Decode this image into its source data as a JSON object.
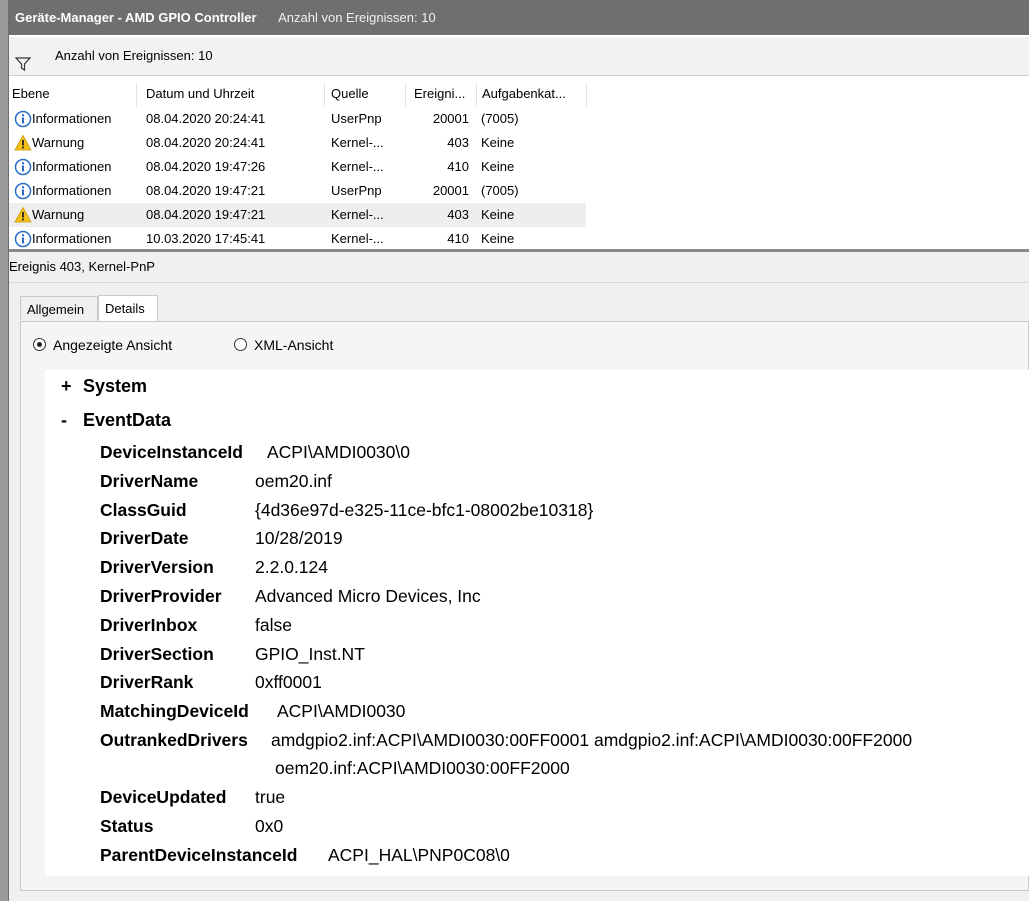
{
  "window": {
    "title": "Geräte-Manager - AMD GPIO Controller",
    "event_count_title": "Anzahl von Ereignissen: 10"
  },
  "filter": {
    "icon": "funnel-icon",
    "label": "Anzahl von Ereignissen: 10"
  },
  "grid": {
    "columns": [
      "Ebene",
      "Datum und Uhrzeit",
      "Quelle",
      "Ereigni...",
      "Aufgabenkat..."
    ],
    "rows": [
      {
        "level": "Informationen",
        "icon": "info-icon",
        "date": "08.04.2020 20:24:41",
        "source": "UserPnp",
        "id": "20001",
        "task": "(7005)",
        "selected": false
      },
      {
        "level": "Warnung",
        "icon": "warning-icon",
        "date": "08.04.2020 20:24:41",
        "source": "Kernel-...",
        "id": "403",
        "task": "Keine",
        "selected": false
      },
      {
        "level": "Informationen",
        "icon": "info-icon",
        "date": "08.04.2020 19:47:26",
        "source": "Kernel-...",
        "id": "410",
        "task": "Keine",
        "selected": false
      },
      {
        "level": "Informationen",
        "icon": "info-icon",
        "date": "08.04.2020 19:47:21",
        "source": "UserPnp",
        "id": "20001",
        "task": "(7005)",
        "selected": false
      },
      {
        "level": "Warnung",
        "icon": "warning-icon",
        "date": "08.04.2020 19:47:21",
        "source": "Kernel-...",
        "id": "403",
        "task": "Keine",
        "selected": true
      },
      {
        "level": "Informationen",
        "icon": "info-icon",
        "date": "10.03.2020 17:45:41",
        "source": "Kernel-...",
        "id": "410",
        "task": "Keine",
        "selected": false
      }
    ]
  },
  "event": {
    "header": "Ereignis 403, Kernel-PnP",
    "tabs": [
      {
        "label": "Allgemein",
        "active": false
      },
      {
        "label": "Details",
        "active": true
      }
    ],
    "view_options": [
      {
        "label": "Angezeigte Ansicht",
        "selected": true
      },
      {
        "label": "XML-Ansicht",
        "selected": false
      }
    ],
    "tree": {
      "system": {
        "sign": "+",
        "label": "System"
      },
      "eventdata": {
        "sign": "-",
        "label": "EventData"
      }
    },
    "fields": [
      {
        "key": "DeviceInstanceId",
        "value": "ACPI\\AMDI0030\\0"
      },
      {
        "key": "DriverName",
        "value": "oem20.inf"
      },
      {
        "key": "ClassGuid",
        "value": "{4d36e97d-e325-11ce-bfc1-08002be10318}"
      },
      {
        "key": "DriverDate",
        "value": "10/28/2019"
      },
      {
        "key": "DriverVersion",
        "value": "2.2.0.124"
      },
      {
        "key": "DriverProvider",
        "value": "Advanced Micro Devices, Inc"
      },
      {
        "key": "DriverInbox",
        "value": "false"
      },
      {
        "key": "DriverSection",
        "value": "GPIO_Inst.NT"
      },
      {
        "key": "DriverRank",
        "value": "0xff0001"
      },
      {
        "key": "MatchingDeviceId",
        "value": "ACPI\\AMDI0030"
      },
      {
        "key": "OutrankedDrivers",
        "value": "amdgpio2.inf:ACPI\\AMDI0030:00FF0001 amdgpio2.inf:ACPI\\AMDI0030:00FF2000",
        "value2": "oem20.inf:ACPI\\AMDI0030:00FF2000"
      },
      {
        "key": "DeviceUpdated",
        "value": "true"
      },
      {
        "key": "Status",
        "value": "0x0"
      },
      {
        "key": "ParentDeviceInstanceId",
        "value": "ACPI_HAL\\PNP0C08\\0"
      }
    ]
  }
}
